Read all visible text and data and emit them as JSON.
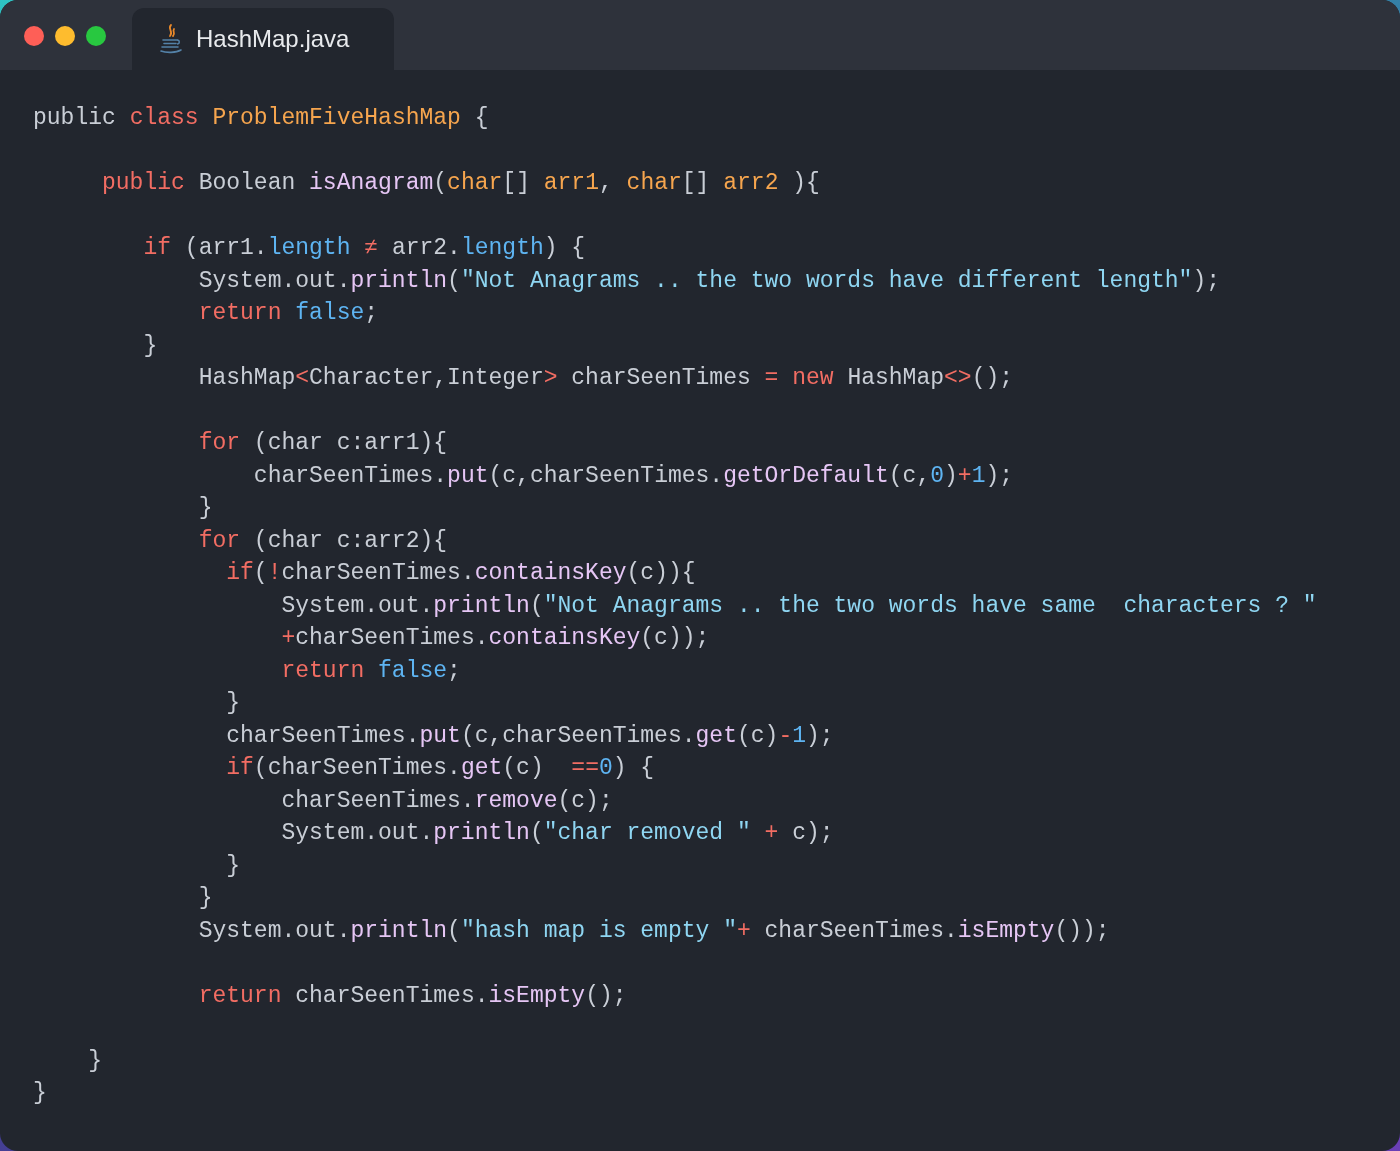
{
  "tab": {
    "label": "HashMap.java",
    "selected": true
  },
  "code_lines": [
    {
      "kind": "code",
      "tokens": [
        {
          "kind": "plain",
          "s": "public "
        },
        {
          "kind": "kw",
          "s": "class "
        },
        {
          "kind": "type",
          "s": "ProblemFiveHashMap"
        },
        {
          "kind": "plain",
          "s": " {"
        }
      ]
    },
    {
      "kind": "blank"
    },
    {
      "kind": "code",
      "tokens": [
        {
          "kind": "kw",
          "s": "     public"
        },
        {
          "kind": "plain",
          "s": " Boolean "
        },
        {
          "kind": "method",
          "s": "isAnagram"
        },
        {
          "kind": "plain",
          "s": "("
        },
        {
          "kind": "type",
          "s": "char"
        },
        {
          "kind": "plain",
          "s": "[] "
        },
        {
          "kind": "type",
          "s": "arr1"
        },
        {
          "kind": "plain",
          "s": ", "
        },
        {
          "kind": "type",
          "s": "char"
        },
        {
          "kind": "plain",
          "s": "[] "
        },
        {
          "kind": "type",
          "s": "arr2"
        },
        {
          "kind": "plain",
          "s": " ){"
        }
      ]
    },
    {
      "kind": "blank"
    },
    {
      "kind": "code",
      "tokens": [
        {
          "kind": "kw",
          "s": "        if"
        },
        {
          "kind": "plain",
          "s": " (arr1."
        },
        {
          "kind": "prop",
          "s": "length"
        },
        {
          "kind": "op",
          "s": " ≠ "
        },
        {
          "kind": "plain",
          "s": "arr2."
        },
        {
          "kind": "prop",
          "s": "length"
        },
        {
          "kind": "plain",
          "s": ") {"
        }
      ]
    },
    {
      "kind": "code",
      "tokens": [
        {
          "kind": "plain",
          "s": "            System.out."
        },
        {
          "kind": "method",
          "s": "println"
        },
        {
          "kind": "plain",
          "s": "("
        },
        {
          "kind": "string",
          "s": "\"Not Anagrams .. the two words have different length\""
        },
        {
          "kind": "plain",
          "s": ");"
        }
      ]
    },
    {
      "kind": "code",
      "tokens": [
        {
          "kind": "kw",
          "s": "            return"
        },
        {
          "kind": "prop",
          "s": " false"
        },
        {
          "kind": "plain",
          "s": ";"
        }
      ]
    },
    {
      "kind": "code",
      "tokens": [
        {
          "kind": "plain",
          "s": "        }"
        }
      ]
    },
    {
      "kind": "code",
      "tokens": [
        {
          "kind": "plain",
          "s": "            HashMap"
        },
        {
          "kind": "op",
          "s": "<"
        },
        {
          "kind": "plain",
          "s": "Character,Integer"
        },
        {
          "kind": "op",
          "s": ">"
        },
        {
          "kind": "plain",
          "s": " charSeenTimes "
        },
        {
          "kind": "op",
          "s": "="
        },
        {
          "kind": "kw",
          "s": " new"
        },
        {
          "kind": "plain",
          "s": " HashMap"
        },
        {
          "kind": "op",
          "s": "<>"
        },
        {
          "kind": "plain",
          "s": "();"
        }
      ]
    },
    {
      "kind": "blank"
    },
    {
      "kind": "code",
      "tokens": [
        {
          "kind": "kw",
          "s": "            for"
        },
        {
          "kind": "plain",
          "s": " (char c:arr1){"
        }
      ]
    },
    {
      "kind": "code",
      "tokens": [
        {
          "kind": "plain",
          "s": "                charSeenTimes."
        },
        {
          "kind": "method",
          "s": "put"
        },
        {
          "kind": "plain",
          "s": "(c,charSeenTimes."
        },
        {
          "kind": "method",
          "s": "getOrDefault"
        },
        {
          "kind": "plain",
          "s": "(c,"
        },
        {
          "kind": "num",
          "s": "0"
        },
        {
          "kind": "plain",
          "s": ")"
        },
        {
          "kind": "op",
          "s": "+"
        },
        {
          "kind": "num",
          "s": "1"
        },
        {
          "kind": "plain",
          "s": ");"
        }
      ]
    },
    {
      "kind": "code",
      "tokens": [
        {
          "kind": "plain",
          "s": "            }"
        }
      ]
    },
    {
      "kind": "code",
      "tokens": [
        {
          "kind": "kw",
          "s": "            for"
        },
        {
          "kind": "plain",
          "s": " (char c:arr2){"
        }
      ]
    },
    {
      "kind": "code",
      "tokens": [
        {
          "kind": "kw",
          "s": "              if"
        },
        {
          "kind": "plain",
          "s": "("
        },
        {
          "kind": "op",
          "s": "!"
        },
        {
          "kind": "plain",
          "s": "charSeenTimes."
        },
        {
          "kind": "method",
          "s": "containsKey"
        },
        {
          "kind": "plain",
          "s": "(c)){"
        }
      ]
    },
    {
      "kind": "code",
      "tokens": [
        {
          "kind": "plain",
          "s": "                  System.out."
        },
        {
          "kind": "method",
          "s": "println"
        },
        {
          "kind": "plain",
          "s": "("
        },
        {
          "kind": "string",
          "s": "\"Not Anagrams .. the two words have same  characters ? \""
        }
      ]
    },
    {
      "kind": "code",
      "tokens": [
        {
          "kind": "op",
          "s": "                  +"
        },
        {
          "kind": "plain",
          "s": "charSeenTimes."
        },
        {
          "kind": "method",
          "s": "containsKey"
        },
        {
          "kind": "plain",
          "s": "(c));"
        }
      ]
    },
    {
      "kind": "code",
      "tokens": [
        {
          "kind": "kw",
          "s": "                  return"
        },
        {
          "kind": "prop",
          "s": " false"
        },
        {
          "kind": "plain",
          "s": ";"
        }
      ]
    },
    {
      "kind": "code",
      "tokens": [
        {
          "kind": "plain",
          "s": "              }"
        }
      ]
    },
    {
      "kind": "code",
      "tokens": [
        {
          "kind": "plain",
          "s": "              charSeenTimes."
        },
        {
          "kind": "method",
          "s": "put"
        },
        {
          "kind": "plain",
          "s": "(c,charSeenTimes."
        },
        {
          "kind": "method",
          "s": "get"
        },
        {
          "kind": "plain",
          "s": "(c)"
        },
        {
          "kind": "op",
          "s": "-"
        },
        {
          "kind": "num",
          "s": "1"
        },
        {
          "kind": "plain",
          "s": ");"
        }
      ]
    },
    {
      "kind": "code",
      "tokens": [
        {
          "kind": "kw",
          "s": "              if"
        },
        {
          "kind": "plain",
          "s": "(charSeenTimes."
        },
        {
          "kind": "method",
          "s": "get"
        },
        {
          "kind": "plain",
          "s": "(c)  "
        },
        {
          "kind": "op",
          "s": "=="
        },
        {
          "kind": "num",
          "s": "0"
        },
        {
          "kind": "plain",
          "s": ") {"
        }
      ]
    },
    {
      "kind": "code",
      "tokens": [
        {
          "kind": "plain",
          "s": "                  charSeenTimes."
        },
        {
          "kind": "method",
          "s": "remove"
        },
        {
          "kind": "plain",
          "s": "(c);"
        }
      ]
    },
    {
      "kind": "code",
      "tokens": [
        {
          "kind": "plain",
          "s": "                  System.out."
        },
        {
          "kind": "method",
          "s": "println"
        },
        {
          "kind": "plain",
          "s": "("
        },
        {
          "kind": "string",
          "s": "\"char removed \""
        },
        {
          "kind": "op",
          "s": " +"
        },
        {
          "kind": "plain",
          "s": " c);"
        }
      ]
    },
    {
      "kind": "code",
      "tokens": [
        {
          "kind": "plain",
          "s": "              }"
        }
      ]
    },
    {
      "kind": "code",
      "tokens": [
        {
          "kind": "plain",
          "s": "            }"
        }
      ]
    },
    {
      "kind": "code",
      "tokens": [
        {
          "kind": "plain",
          "s": "            System.out."
        },
        {
          "kind": "method",
          "s": "println"
        },
        {
          "kind": "plain",
          "s": "("
        },
        {
          "kind": "string",
          "s": "\"hash map is empty \""
        },
        {
          "kind": "op",
          "s": "+"
        },
        {
          "kind": "plain",
          "s": " charSeenTimes."
        },
        {
          "kind": "method",
          "s": "isEmpty"
        },
        {
          "kind": "plain",
          "s": "());"
        }
      ]
    },
    {
      "kind": "blank"
    },
    {
      "kind": "code",
      "tokens": [
        {
          "kind": "kw",
          "s": "            return"
        },
        {
          "kind": "plain",
          "s": " charSeenTimes."
        },
        {
          "kind": "method",
          "s": "isEmpty"
        },
        {
          "kind": "plain",
          "s": "();"
        }
      ]
    },
    {
      "kind": "blank"
    },
    {
      "kind": "code",
      "tokens": [
        {
          "kind": "plain",
          "s": "    }"
        }
      ]
    },
    {
      "kind": "code",
      "tokens": [
        {
          "kind": "plain",
          "s": "}"
        }
      ]
    }
  ]
}
